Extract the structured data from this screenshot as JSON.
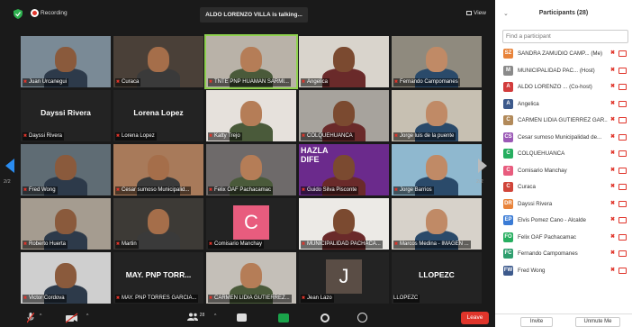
{
  "top_bar": {
    "recording_label": "Recording",
    "talking_banner": "ALDO LORENZO VILLA is talking...",
    "view_label": "View"
  },
  "pager": {
    "left": "2/2",
    "right": "2/2"
  },
  "tiles": [
    {
      "label": "Juan Urcanegui",
      "bg": "#7a8a96"
    },
    {
      "label": "Curaca",
      "bg": "#4a4038"
    },
    {
      "label": "TNTE PNP HUAMAN SARMI...",
      "bg": "#b9b2a8"
    },
    {
      "label": "Angelica",
      "bg": "#d9d4cc"
    },
    {
      "label": "Fernando Campomanes",
      "bg": "#8f8a7e"
    },
    {
      "label": "Dayssi Rivera",
      "big": "Dayssi Rivera",
      "bg": "#232323"
    },
    {
      "label": "Lorena Lopez",
      "big": "Lorena Lopez",
      "bg": "#232323"
    },
    {
      "label": "Katty Trejo",
      "bg": "#e6e1dc"
    },
    {
      "label": "COLQUEHUANCA",
      "bg": "#a7a39d"
    },
    {
      "label": "Jorge luis de la puente",
      "bg": "#c7c0b2"
    },
    {
      "label": "Fred Wong",
      "bg": "#5f6c74"
    },
    {
      "label": "Cesar sumoso Municipalid...",
      "bg": "#a87a5a"
    },
    {
      "label": "Felix OAF Pachacamac",
      "bg": "#6e6a6a"
    },
    {
      "label": "Guido Silva Pisconte",
      "bg": "#6b2a8c",
      "banner": "HAZLA DIFE"
    },
    {
      "label": "Jorge Barrios",
      "bg": "#8fb8cf"
    },
    {
      "label": "Roberto Huerta",
      "bg": "#a59c90"
    },
    {
      "label": "Martin",
      "bg": "#3d3a36"
    },
    {
      "label": "Comisario Manchay",
      "bg": "#232323",
      "avatar": "C"
    },
    {
      "label": "MUNICIPALIDAD PACHACA...",
      "bg": "#eceae6"
    },
    {
      "label": "Marcos Medina - IMAGEN ...",
      "bg": "#d7d2ca"
    },
    {
      "label": "Victor Cordova",
      "bg": "#cfcfcf"
    },
    {
      "label": "MAY. PNP TORRES GARCIA...",
      "big": "MAY. PNP TORR...",
      "bg": "#232323"
    },
    {
      "label": "CARMEN LIDIA GUTIERREZ...",
      "bg": "#c4bfb8"
    },
    {
      "label": "Jean Lazo",
      "bg": "#232323",
      "avatar": "J"
    },
    {
      "label": "LLOPEZC",
      "big": "LLOPEZC",
      "bg": "#232323",
      "nomic": true
    }
  ],
  "toolbar": {
    "participants_count": "28",
    "leave_label": "Leave"
  },
  "panel": {
    "title": "Participants (28)",
    "search_placeholder": "Find a participant",
    "participants": [
      {
        "initials": "SZ",
        "name": "SANDRA ZAMUDIO CAMP... (Me)",
        "color": "#e8833a"
      },
      {
        "initials": "M",
        "name": "MUNICIPALIDAD PAC... (Host)",
        "color": "#8a8a8a"
      },
      {
        "initials": "A",
        "name": "ALDO LORENZO ... (Co-host)",
        "color": "#d23c3c"
      },
      {
        "initials": "A",
        "name": "Angelica",
        "color": "#3d5a8c"
      },
      {
        "initials": "C",
        "name": "CARMEN LIDIA GUTIERREZ GAR...",
        "color": "#b28a5a"
      },
      {
        "initials": "CS",
        "name": "Cesar sumoso Municipalidad de...",
        "color": "#9b59b6"
      },
      {
        "initials": "C",
        "name": "COLQUEHUANCA",
        "color": "#27ae60"
      },
      {
        "initials": "C",
        "name": "Comisario Manchay",
        "color": "#e85c7e"
      },
      {
        "initials": "C",
        "name": "Curaca",
        "color": "#d0453a"
      },
      {
        "initials": "DR",
        "name": "Dayssi Rivera",
        "color": "#e8833a"
      },
      {
        "initials": "EP",
        "name": "Elvis Pomez Cano - Alcalde",
        "color": "#3a7bd5"
      },
      {
        "initials": "FO",
        "name": "Felix OAF Pachacamac",
        "color": "#27ae60"
      },
      {
        "initials": "FC",
        "name": "Fernando Campomanes",
        "color": "#2e9e6e"
      },
      {
        "initials": "FW",
        "name": "Fred Wong",
        "color": "#3d5a8c"
      }
    ],
    "invite_label": "Invite",
    "unmute_label": "Unmute Me"
  }
}
